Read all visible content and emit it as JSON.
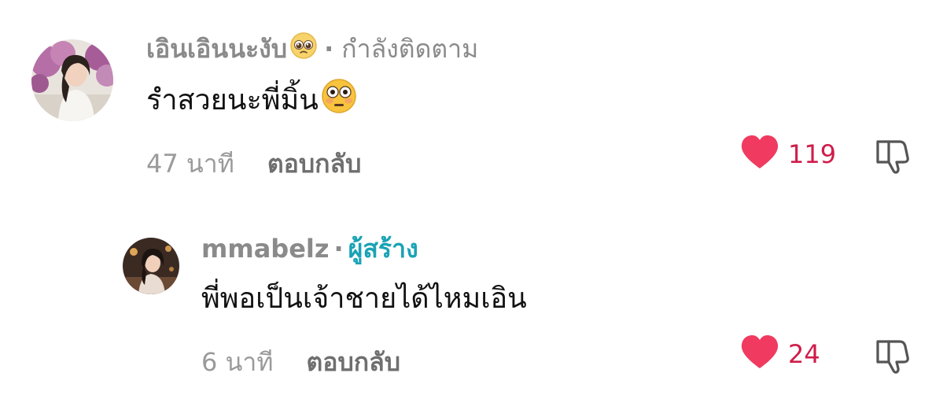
{
  "comments": [
    {
      "username": "เอินเอินนะงับ",
      "username_emoji": "pleading-face-icon",
      "separator": "·",
      "tag": "กำลังติดตาม",
      "text": "รำสวยนะพี่มิ้น",
      "text_emoji": "flushed-face-icon",
      "time": "47 นาที",
      "reply_label": "ตอบกลับ",
      "like_count": "119"
    },
    {
      "username": "mmabelz",
      "separator": "·",
      "tag": "ผู้สร้าง",
      "text": "พี่พอเป็นเจ้าชายได้ไหมเอิน",
      "time": "6 นาที",
      "reply_label": "ตอบกลับ",
      "like_count": "24"
    }
  ],
  "colors": {
    "heart": "#f03a5f",
    "like_count": "#cf1d4a",
    "creator_tag": "#1aa3b5",
    "muted": "#8a8a8a"
  }
}
